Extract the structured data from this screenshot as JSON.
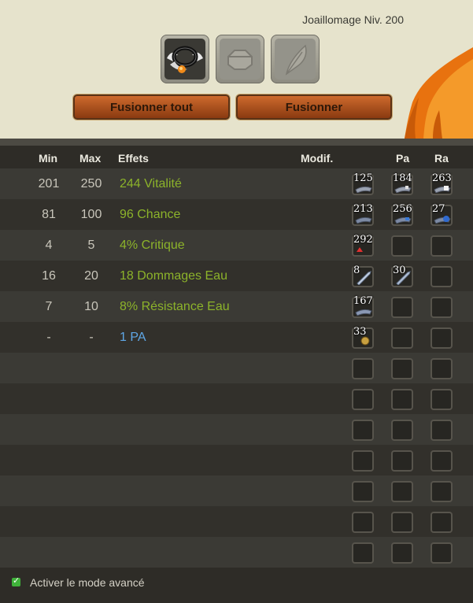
{
  "header": {
    "level_label": "Joaillomage Niv. 200"
  },
  "buttons": {
    "fuse_all": "Fusionner tout",
    "fuse": "Fusionner"
  },
  "columns": {
    "min": "Min",
    "max": "Max",
    "effects": "Effets",
    "modif": "Modif.",
    "pa": "Pa",
    "ra": "Ra"
  },
  "rows": [
    {
      "min": "201",
      "max": "250",
      "effect": "244 Vitalité",
      "ba": "125",
      "pa": "184",
      "ra": "263"
    },
    {
      "min": "81",
      "max": "100",
      "effect": "96 Chance",
      "ba": "213",
      "pa": "256",
      "ra": "27"
    },
    {
      "min": "4",
      "max": "5",
      "effect": "4% Critique",
      "ba": "292",
      "pa": "",
      "ra": ""
    },
    {
      "min": "16",
      "max": "20",
      "effect": "18 Dommages Eau",
      "ba": "8",
      "pa": "30",
      "ra": ""
    },
    {
      "min": "7",
      "max": "10",
      "effect": "8% Résistance Eau",
      "ba": "167",
      "pa": "",
      "ra": ""
    },
    {
      "min": "-",
      "max": "-",
      "effect": "1 PA",
      "ba": "33",
      "pa": "",
      "ra": ""
    }
  ],
  "footer": {
    "advanced_mode_label": "Activer le mode avancé",
    "advanced_mode_checked": true
  },
  "colors": {
    "effect_green": "#8cb32a",
    "effect_blue": "#5fa7e6",
    "button_orange": "#cd6a2d"
  }
}
